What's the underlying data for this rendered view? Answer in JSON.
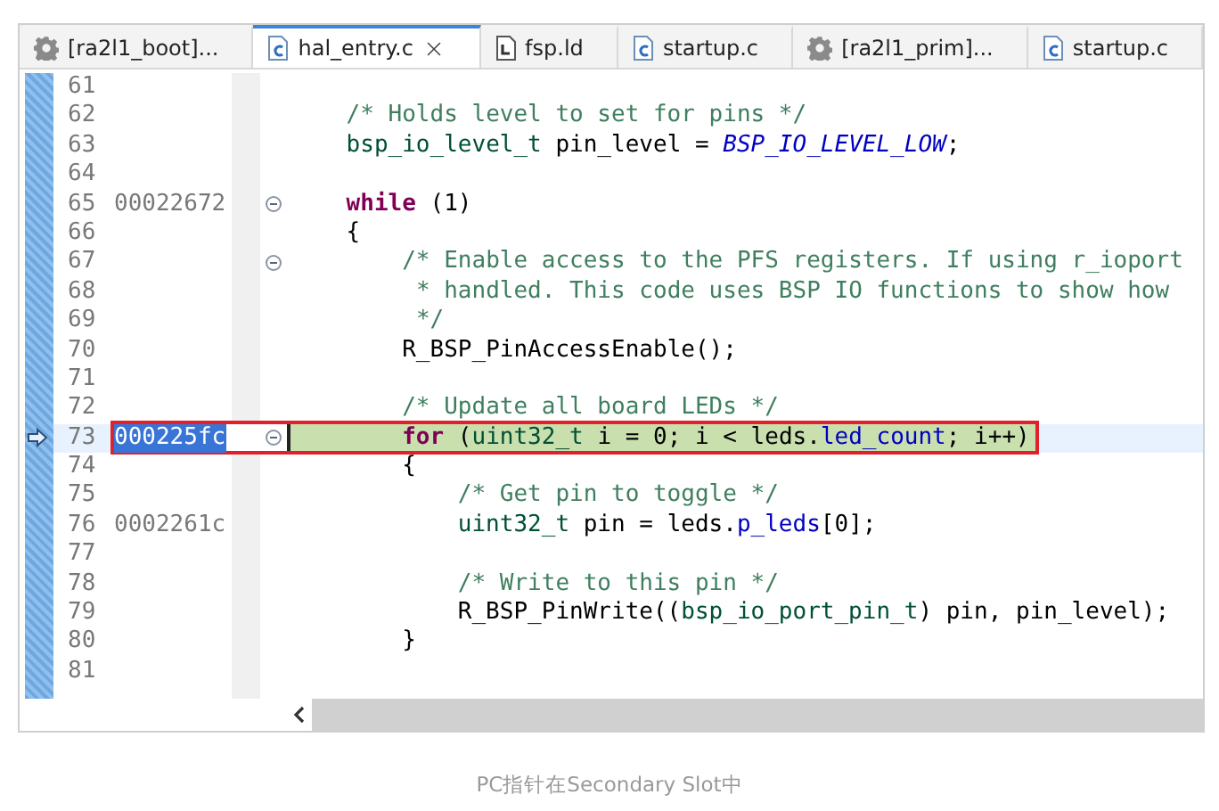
{
  "tabs": [
    {
      "label": "[ra2l1_boot]...",
      "kind": "project",
      "selected": false
    },
    {
      "label": "hal_entry.c",
      "kind": "source",
      "selected": true
    },
    {
      "label": "fsp.ld",
      "kind": "linker",
      "selected": false
    },
    {
      "label": "startup.c",
      "kind": "source",
      "selected": false
    },
    {
      "label": "[ra2l1_prim]...",
      "kind": "project",
      "selected": false
    },
    {
      "label": "startup.c",
      "kind": "source",
      "selected": false
    }
  ],
  "lines": [
    {
      "number": "61",
      "fold": false,
      "current": false
    },
    {
      "number": "62",
      "fold": false,
      "current": false,
      "tokens": [
        {
          "kind": "comment",
          "text": "    /* Holds level to set for pins */"
        }
      ]
    },
    {
      "number": "63",
      "fold": false,
      "current": false,
      "tokens": [
        {
          "kind": "type",
          "text": "    bsp_io_level_t"
        },
        {
          "kind": "plain",
          "text": " pin_level = "
        },
        {
          "kind": "constant",
          "text": "BSP_IO_LEVEL_LOW"
        },
        {
          "kind": "plain",
          "text": ";"
        }
      ]
    },
    {
      "number": "64",
      "fold": false,
      "current": false
    },
    {
      "number": "65",
      "address": "00022672",
      "fold": true,
      "current": false,
      "tokens": [
        {
          "kind": "keyword",
          "text": "    while"
        },
        {
          "kind": "plain",
          "text": " (1)"
        }
      ]
    },
    {
      "number": "66",
      "fold": false,
      "current": false,
      "tokens": [
        {
          "kind": "plain",
          "text": "    {"
        }
      ]
    },
    {
      "number": "67",
      "fold": true,
      "current": false,
      "tokens": [
        {
          "kind": "comment",
          "text": "        /* Enable access to the PFS registers. If using r_ioport"
        }
      ]
    },
    {
      "number": "68",
      "fold": false,
      "current": false,
      "tokens": [
        {
          "kind": "comment",
          "text": "         * handled. This code uses BSP IO functions to show how"
        }
      ]
    },
    {
      "number": "69",
      "fold": false,
      "current": false,
      "tokens": [
        {
          "kind": "comment",
          "text": "         */"
        }
      ]
    },
    {
      "number": "70",
      "fold": false,
      "current": false,
      "tokens": [
        {
          "kind": "plain",
          "text": "        R_BSP_PinAccessEnable();"
        }
      ]
    },
    {
      "number": "71",
      "fold": false,
      "current": false
    },
    {
      "number": "72",
      "fold": false,
      "current": false,
      "tokens": [
        {
          "kind": "comment",
          "text": "        /* Update all board LEDs */"
        }
      ]
    },
    {
      "number": "73",
      "address": "000225fc",
      "fold": true,
      "current": true,
      "tokens": [
        {
          "kind": "keyword",
          "text": "        for"
        },
        {
          "kind": "plain",
          "text": " ("
        },
        {
          "kind": "type",
          "text": "uint32_t"
        },
        {
          "kind": "plain",
          "text": " i = 0; i < leds."
        },
        {
          "kind": "field",
          "text": "led_count"
        },
        {
          "kind": "plain",
          "text": "; i++)"
        }
      ]
    },
    {
      "number": "74",
      "fold": false,
      "current": false,
      "tokens": [
        {
          "kind": "plain",
          "text": "        {"
        }
      ]
    },
    {
      "number": "75",
      "fold": false,
      "current": false,
      "tokens": [
        {
          "kind": "comment",
          "text": "            /* Get pin to toggle */"
        }
      ]
    },
    {
      "number": "76",
      "address": "0002261c",
      "fold": false,
      "current": false,
      "tokens": [
        {
          "kind": "type",
          "text": "            uint32_t"
        },
        {
          "kind": "plain",
          "text": " pin = leds."
        },
        {
          "kind": "field",
          "text": "p_leds"
        },
        {
          "kind": "plain",
          "text": "[0];"
        }
      ]
    },
    {
      "number": "77",
      "fold": false,
      "current": false
    },
    {
      "number": "78",
      "fold": false,
      "current": false,
      "tokens": [
        {
          "kind": "comment",
          "text": "            /* Write to this pin */"
        }
      ]
    },
    {
      "number": "79",
      "fold": false,
      "current": false,
      "tokens": [
        {
          "kind": "plain",
          "text": "            R_BSP_PinWrite(("
        },
        {
          "kind": "type",
          "text": "bsp_io_port_pin_t"
        },
        {
          "kind": "plain",
          "text": ") pin, pin_level);"
        }
      ]
    },
    {
      "number": "80",
      "fold": false,
      "current": false,
      "tokens": [
        {
          "kind": "plain",
          "text": "        }"
        }
      ]
    },
    {
      "number": "81",
      "fold": false,
      "current": false
    }
  ],
  "caption": "PC指针在Secondary Slot中"
}
